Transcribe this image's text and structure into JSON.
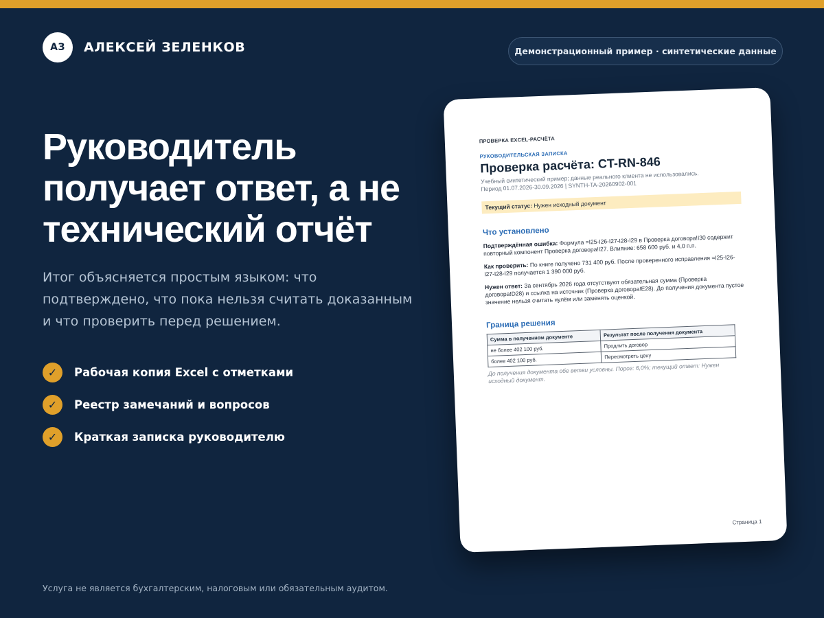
{
  "brand": {
    "initials": "АЗ",
    "name": "АЛЕКСЕЙ ЗЕЛЕНКОВ"
  },
  "demo_badge": "Демонстрационный пример · синтетические данные",
  "headline": "Руководитель получает ответ, а не технический отчёт",
  "subtext": "Итог объясняется простым языком: что подтверждено, что пока нельзя считать доказанным и что проверить перед решением.",
  "features": [
    {
      "icon": "check-icon",
      "label": "Рабочая копия Excel с отметками"
    },
    {
      "icon": "check-icon",
      "label": "Реестр замечаний и вопросов"
    },
    {
      "icon": "check-icon",
      "label": "Краткая записка руководителю"
    }
  ],
  "footer_note": "Услуга не является бухгалтерским, налоговым или обязательным аудитом.",
  "colors": {
    "background": "#10253f",
    "accent": "#e0a02a",
    "doc_blue": "#2b6cb5",
    "status_bg": "#fdecc0"
  },
  "document": {
    "header": "ПРОВЕРКА EXCEL-РАСЧЁТА",
    "kicker": "РУКОВОДИТЕЛЬСКАЯ ЗАПИСКА",
    "title": "Проверка расчёта: CT-RN-846",
    "subtitle": "Учебный синтетический пример; данные реального клиента не использовались. Период 01.07.2026-30.09.2026 | SYNTH-TA-20260902-001",
    "status_label": "Текущий статус:",
    "status_value": "Нужен исходный документ",
    "section1_title": "Что установлено",
    "findings": [
      {
        "label": "Подтверждённая ошибка:",
        "text": "Формула =I25-I26-I27-I28-I29 в Проверка договора!I30 содержит повторный компонент Проверка договора!I27. Влияние: 658 600 руб. и 4,0 п.п."
      },
      {
        "label": "Как проверить:",
        "text": "По книге получено 731 400 руб. После проверенного исправления =I25-I26-I27-I28-I29 получается 1 390 000 руб."
      },
      {
        "label": "Нужен ответ:",
        "text": "За сентябрь 2026 года отсутствуют обязательная сумма (Проверка договора!D28) и ссылка на источник (Проверка договора!E28). До получения документа пустое значение нельзя считать нулём или заменять оценкой."
      }
    ],
    "section2_title": "Граница решения",
    "table": {
      "headers": [
        "Сумма в полученном документе",
        "Результат после получения документа"
      ],
      "rows": [
        [
          "не более 402 100 руб.",
          "Продлить договор"
        ],
        [
          "более 402 100 руб.",
          "Пересмотреть цену"
        ]
      ]
    },
    "note": "До получения документа обе ветви условны. Порог: 6,0%; текущий ответ: Нужен исходный документ.",
    "page_label": "Страница 1"
  }
}
